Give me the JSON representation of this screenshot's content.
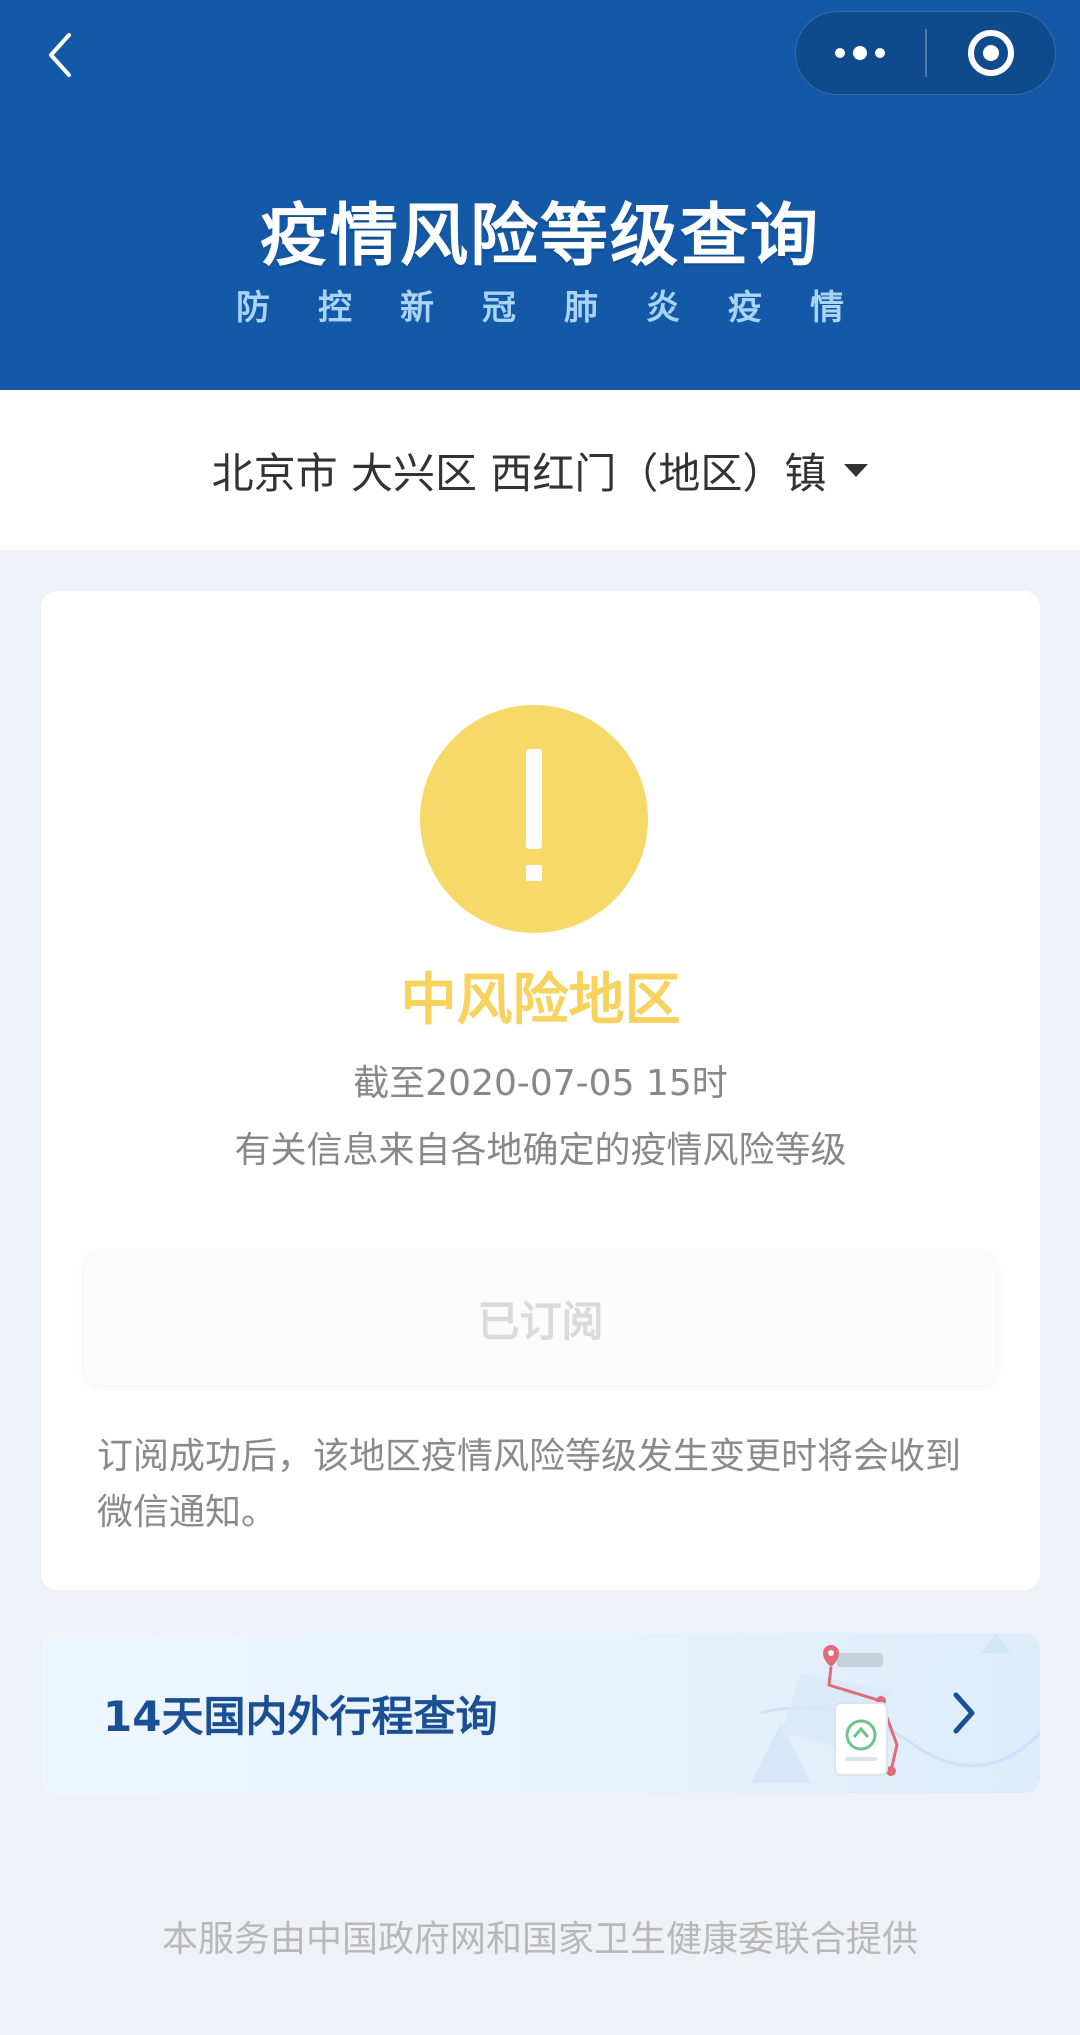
{
  "header": {
    "title": "疫情风险等级查询",
    "subtitle_chars": [
      "防",
      "控",
      "新",
      "冠",
      "肺",
      "炎",
      "疫",
      "情"
    ],
    "back_icon": "chevron-left-icon",
    "more_icon": "more-dots-icon",
    "close_icon": "target-ring-icon"
  },
  "location": {
    "text": "北京市 大兴区 西红门（地区）镇",
    "dropdown_icon": "caret-down-icon"
  },
  "risk_card": {
    "icon": "exclamation-icon",
    "level": "中风险地区",
    "as_of": "截至2020-07-05 15时",
    "source": "有关信息来自各地确定的疫情风险等级",
    "subscribe_button": "已订阅",
    "note": "订阅成功后，该地区疫情风险等级发生变更时将会收到微信通知。"
  },
  "travel_query": {
    "label": "14天国内外行程查询",
    "icon": "chevron-right-icon"
  },
  "footer": {
    "text": "本服务由中国政府网和国家卫生健康委联合提供"
  },
  "colors": {
    "header_bg": "#1459a8",
    "risk_yellow": "#f7d96a",
    "page_bg": "#eef1f6",
    "link_blue": "#1a4f93"
  }
}
